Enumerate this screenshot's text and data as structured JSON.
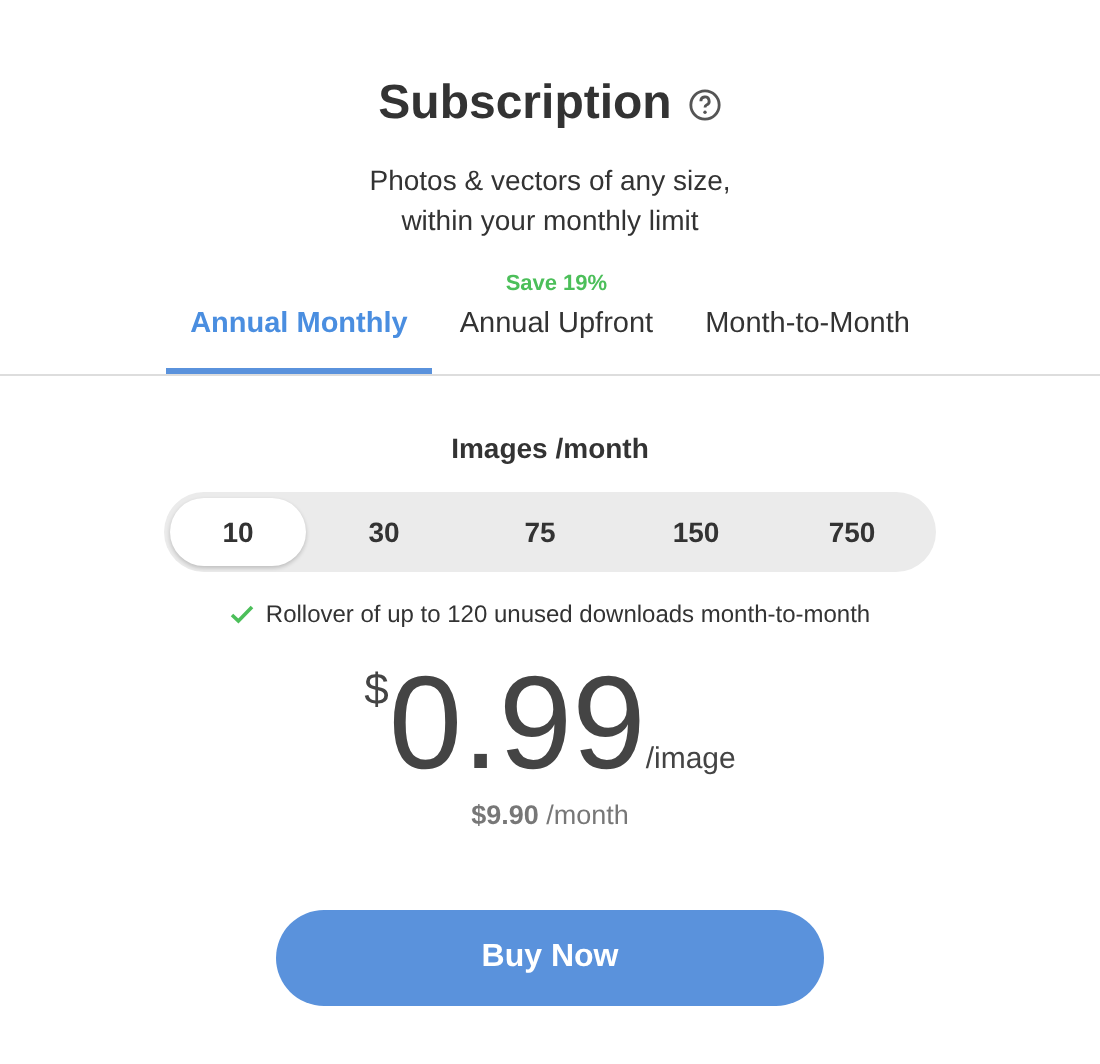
{
  "title": "Subscription",
  "subtitle_lines": [
    "Photos & vectors of any size,",
    "within your monthly limit"
  ],
  "tabs": [
    {
      "label": "Annual Monthly",
      "selected": true
    },
    {
      "label": "Annual Upfront",
      "selected": false,
      "badge": "Save 19%"
    },
    {
      "label": "Month-to-Month",
      "selected": false
    }
  ],
  "quantity": {
    "label": "Images /month",
    "options": [
      {
        "label": "10",
        "selected": true
      },
      {
        "label": "30",
        "selected": false
      },
      {
        "label": "75",
        "selected": false
      },
      {
        "label": "150",
        "selected": false
      },
      {
        "label": "750",
        "selected": false
      }
    ]
  },
  "rollover_note": "Rollover of up to 120 unused downloads month-to-month",
  "price": {
    "currency": "$",
    "amount": "0.99",
    "unit": "/image",
    "monthly": "**$9.90** /month"
  },
  "buy_button": "Buy Now"
}
